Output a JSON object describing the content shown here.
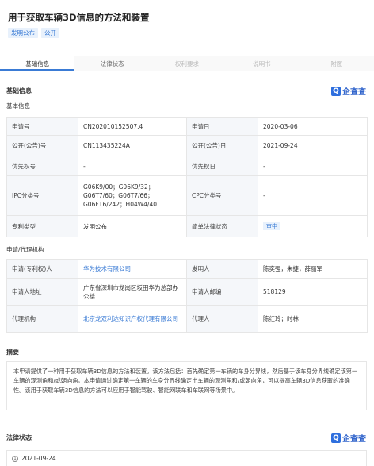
{
  "header": {
    "title": "用于获取车辆3D信息的方法和装置",
    "tags": [
      "发明公布",
      "公开"
    ]
  },
  "tabs": [
    {
      "label": "基础信息",
      "state": "active"
    },
    {
      "label": "法律状态",
      "state": "normal"
    },
    {
      "label": "权利要求",
      "state": "disabled"
    },
    {
      "label": "说明书",
      "state": "disabled"
    },
    {
      "label": "附图",
      "state": "disabled"
    }
  ],
  "basic": {
    "section_title": "基础信息",
    "brand": "企查查",
    "brand_logo_char": "Q",
    "subtitle": "基本信息",
    "rows": [
      {
        "k1": "申请号",
        "v1": "CN202010152507.4",
        "k2": "申请日",
        "v2": "2020-03-06"
      },
      {
        "k1": "公开(公告)号",
        "v1": "CN113435224A",
        "k2": "公开(公告)日",
        "v2": "2021-09-24"
      },
      {
        "k1": "优先权号",
        "v1": "-",
        "k2": "优先权日",
        "v2": "-"
      },
      {
        "k1": "IPC分类号",
        "v1": "G06K9/00；G06K9/32；G06T7/60；G06T7/66；G06F16/242；H04W4/40",
        "k2": "CPC分类号",
        "v2": "-"
      },
      {
        "k1": "专利类型",
        "v1": "发明公布",
        "k2": "简单法律状态",
        "v2": "审中"
      }
    ]
  },
  "applicant": {
    "subtitle": "申请/代理机构",
    "rows": [
      {
        "k1": "申请(专利权)人",
        "v1": "华为技术有限公司",
        "k2": "发明人",
        "v2": "陈奕强，朱捷，薛丽军"
      },
      {
        "k1": "申请人地址",
        "v1": "广东省深圳市龙岗区坂田华为总部办公楼",
        "k2": "申请人邮编",
        "v2": "518129"
      },
      {
        "k1": "代理机构",
        "v1": "北京龙双利达知识产权代理有限公司",
        "k2": "代理人",
        "v2": "陈红玲；时林"
      }
    ]
  },
  "abstract": {
    "title": "摘要",
    "text": "本申请提供了一种用于获取车辆3D信息的方法和装置。该方法包括：首先确定第一车辆的车身分界线，然后基于该车身分界线确定该第一车辆的观测角和/或朝向角。本申请通过确定第一车辆的车身分界线确定出车辆的观测角和/或朝向角，可以提高车辆3D信息获取的准确性。该用于获取车辆3D信息的方法可以应用于智能驾驶、智能网联车和车联网等场景中。"
  },
  "legal": {
    "title": "法律状态",
    "brand": "企查查",
    "brand_logo_char": "Q",
    "first_index": "1",
    "first_date": "2021-09-24"
  }
}
